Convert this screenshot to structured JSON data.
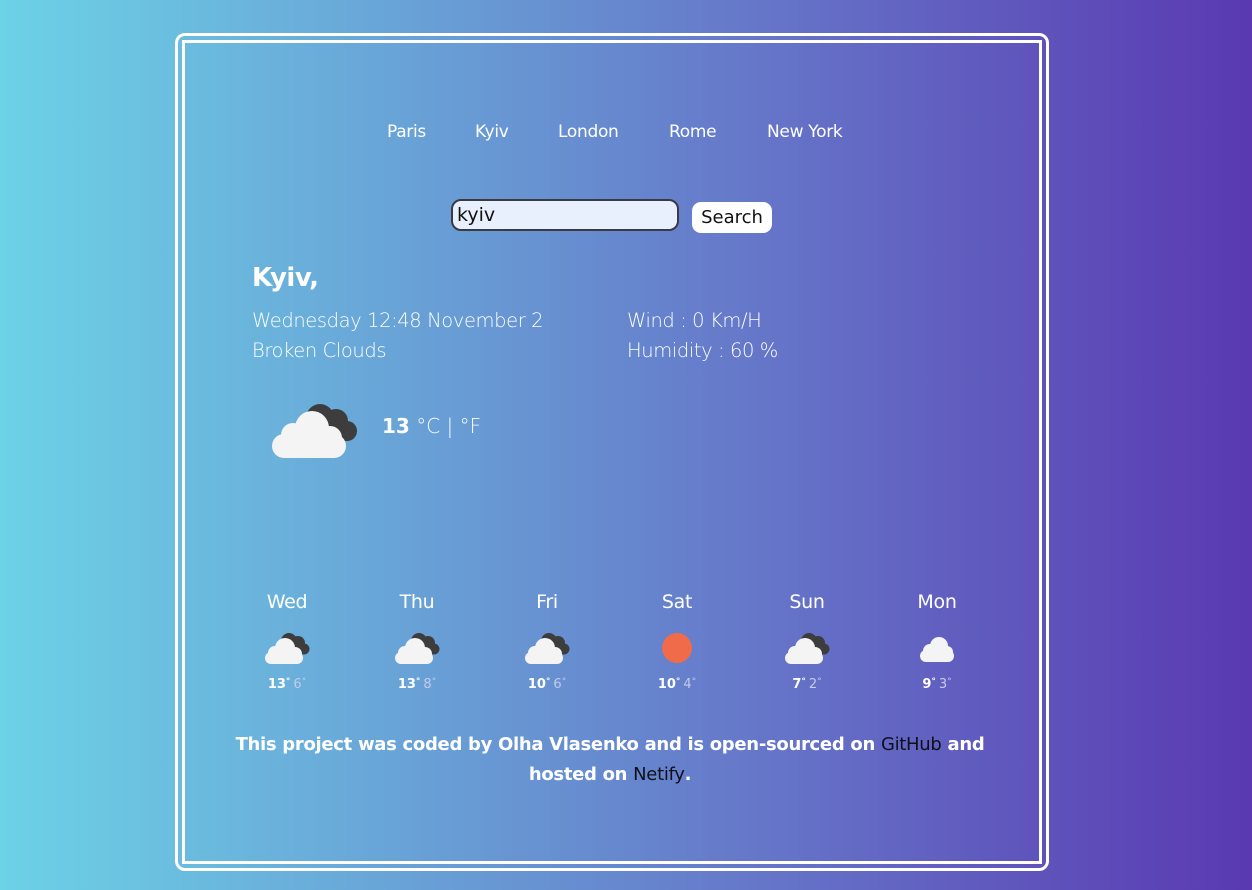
{
  "nav": {
    "cities": [
      "Paris",
      "Kyiv",
      "London",
      "Rome",
      "New York"
    ]
  },
  "search": {
    "value": "kyiv",
    "button_label": "Search"
  },
  "current": {
    "city": "Kyiv,",
    "datetime": "Wednesday 12:48 November 2",
    "description": "Broken Clouds",
    "wind": "Wind : 0 Km/H",
    "humidity": "Humidity : 60 %",
    "temperature": "13",
    "unit_celsius": "°C",
    "unit_separator": "|",
    "unit_fahrenheit": "°F",
    "icon": "broken-clouds-icon"
  },
  "forecast": [
    {
      "day": "Wed",
      "max": "13",
      "min": "6",
      "icon": "broken-clouds-icon"
    },
    {
      "day": "Thu",
      "max": "13",
      "min": "8",
      "icon": "broken-clouds-icon"
    },
    {
      "day": "Fri",
      "max": "10",
      "min": "6",
      "icon": "broken-clouds-icon"
    },
    {
      "day": "Sat",
      "max": "10",
      "min": "4",
      "icon": "clear-sky-sun-icon"
    },
    {
      "day": "Sun",
      "max": "7",
      "min": "2",
      "icon": "broken-clouds-icon"
    },
    {
      "day": "Mon",
      "max": "9",
      "min": "3",
      "icon": "cloud-icon"
    }
  ],
  "degree_symbol": "°",
  "footer": {
    "text_before": "This project was coded by Olha Vlasenko and is open-sourced on",
    "github_label": "GitHub",
    "text_middle": "and hosted on",
    "netlify_label": "Netify",
    "text_end": "."
  },
  "colors": {
    "sun": "#ef6b4a",
    "cloud_front": "#f4f4f4",
    "cloud_back": "#3d3d3d",
    "link_dark": "#10101a"
  }
}
